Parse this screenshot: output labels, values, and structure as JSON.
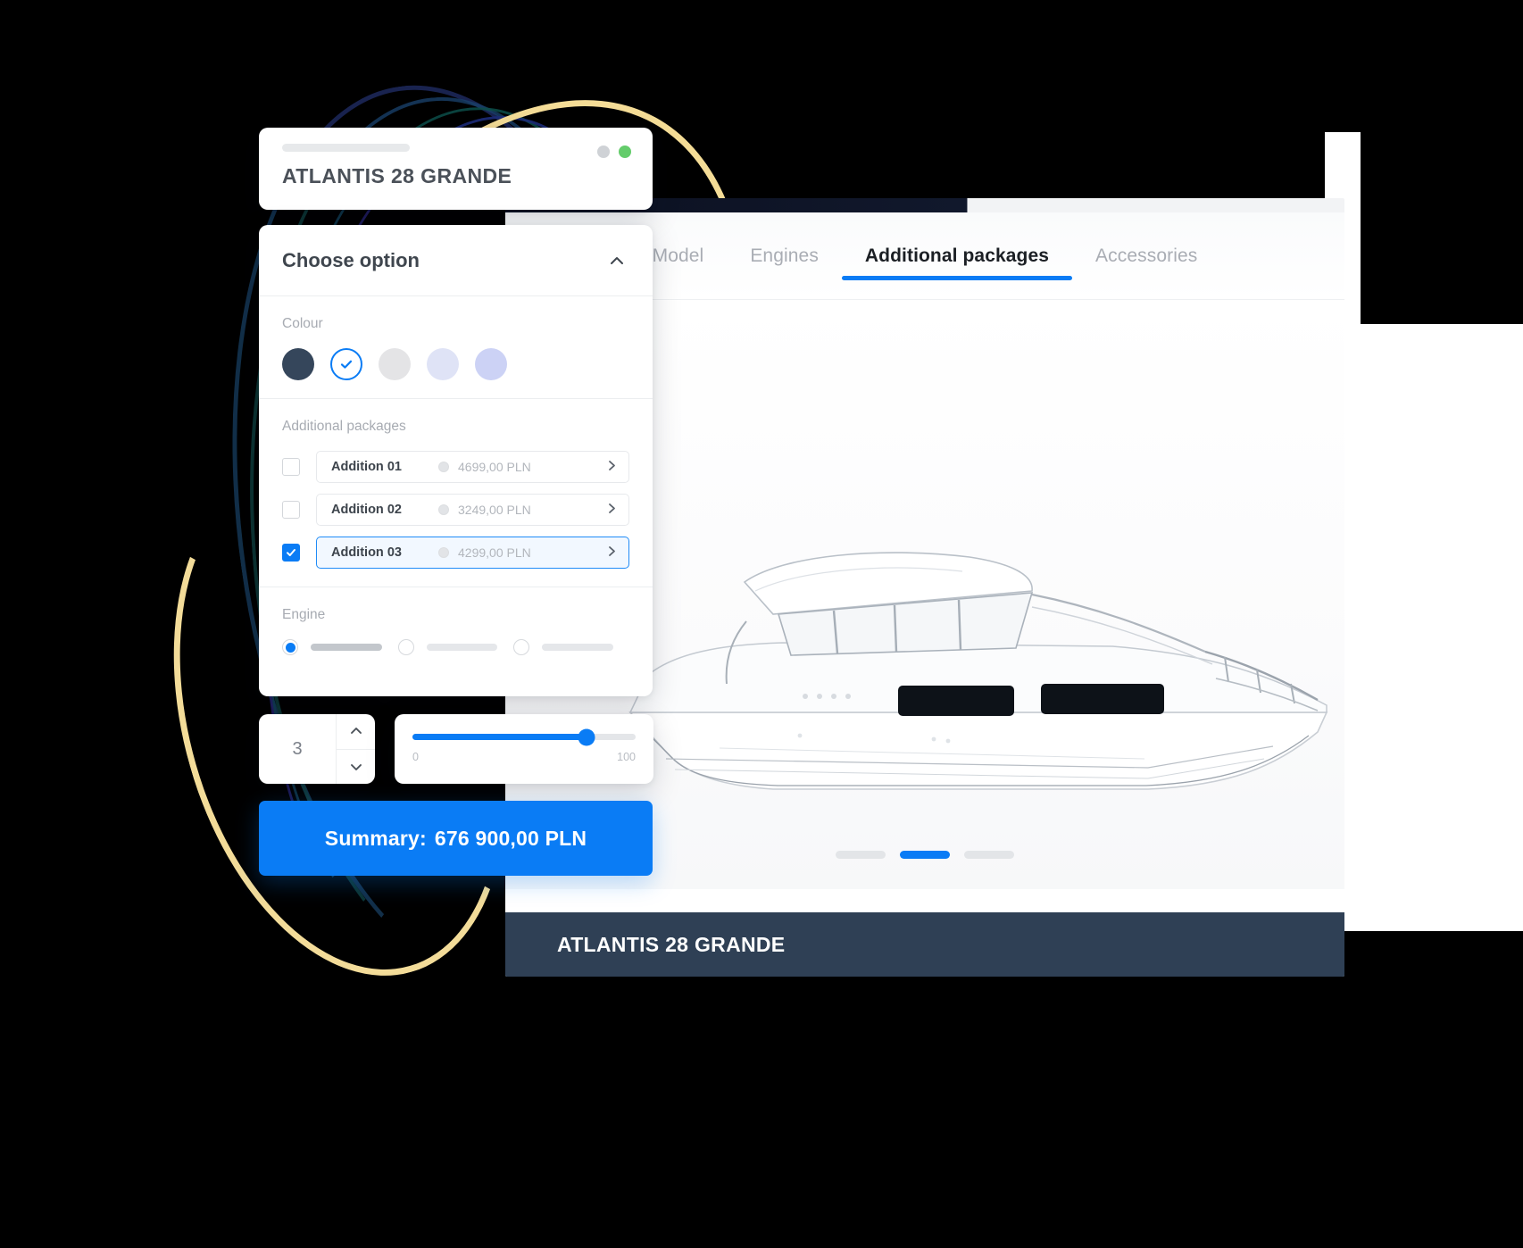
{
  "title_card": {
    "model_name": "ATLANTIS 28 GRANDE",
    "dot_grey": "window-dot-grey",
    "dot_green": "window-dot-green"
  },
  "options_card": {
    "header": "Choose option",
    "collapse_icon": "chevron-up-icon",
    "colour": {
      "label": "Colour",
      "swatches": [
        {
          "name": "dark-navy",
          "hex": "#35465b",
          "selected": false
        },
        {
          "name": "selected-marker",
          "hex": "#ffffff",
          "selected": true
        },
        {
          "name": "light-grey",
          "hex": "#e4e4e6",
          "selected": false
        },
        {
          "name": "pale-lavender",
          "hex": "#dfe3f6",
          "selected": false
        },
        {
          "name": "periwinkle",
          "hex": "#ccd2f5",
          "selected": false
        }
      ]
    },
    "packages": {
      "label": "Additional packages",
      "items": [
        {
          "name": "Addition 01",
          "price": "4699,00 PLN",
          "checked": false
        },
        {
          "name": "Addition 02",
          "price": "3249,00 PLN",
          "checked": false
        },
        {
          "name": "Addition 03",
          "price": "4299,00 PLN",
          "checked": true
        }
      ],
      "row_chevron": "chevron-right-icon"
    },
    "engine": {
      "label": "Engine",
      "options": [
        {
          "name": "engine-option-1",
          "selected": true
        },
        {
          "name": "engine-option-2",
          "selected": false
        },
        {
          "name": "engine-option-3",
          "selected": false
        }
      ]
    }
  },
  "stepper": {
    "value": "3",
    "increment_icon": "chevron-up-icon",
    "decrement_icon": "chevron-down-icon"
  },
  "slider": {
    "min_label": "0",
    "max_label": "100",
    "value": 78
  },
  "summary": {
    "label": "Summary:",
    "amount": "676 900,00 PLN"
  },
  "browser": {
    "tabs": [
      {
        "label": "Model",
        "active": false
      },
      {
        "label": "Engines",
        "active": false
      },
      {
        "label": "Additional packages",
        "active": true
      },
      {
        "label": "Accessories",
        "active": false
      }
    ],
    "pagination": [
      {
        "name": "page-dot-1",
        "active": false
      },
      {
        "name": "page-dot-2",
        "active": true
      },
      {
        "name": "page-dot-3",
        "active": false
      }
    ],
    "bottom_bar_title": "ATLANTIS 28 GRANDE",
    "product_image": "motor-yacht-side-view"
  },
  "colors": {
    "accent": "#0a7cf5",
    "bottom_bar": "#2f4055",
    "decor_yellow": "#f3dc99"
  }
}
